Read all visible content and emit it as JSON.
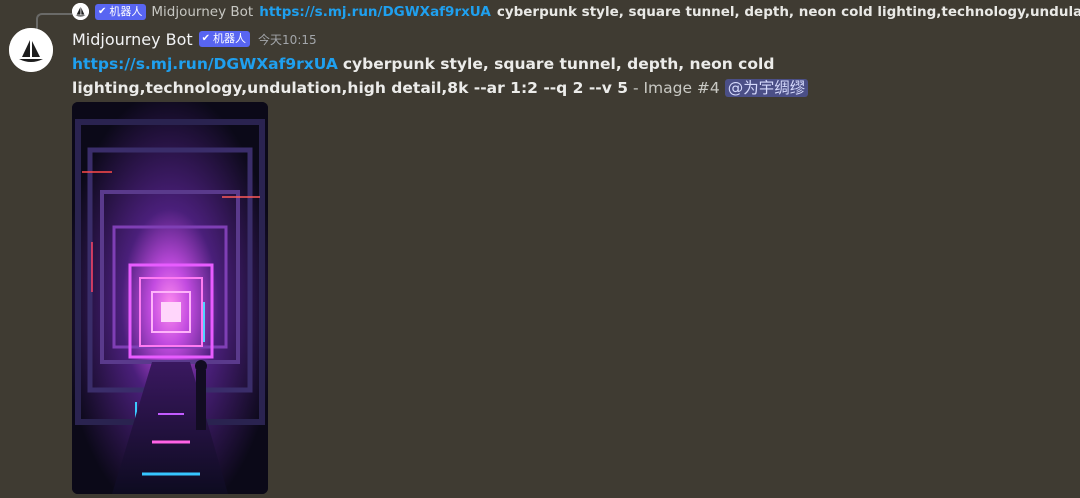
{
  "reply": {
    "bot_tag": "机器人",
    "author": "Midjourney Bot",
    "link": "https://s.mj.run/DGWXaf9rxUA",
    "text": "cyberpunk style, square tunnel, depth, neon cold lighting,technology,undula",
    "icon": "image-icon"
  },
  "message": {
    "author": "Midjourney Bot",
    "bot_tag": "机器人",
    "timestamp": "今天10:15",
    "link": "https://s.mj.run/DGWXaf9rxUA",
    "prompt": "cyberpunk style, square tunnel, depth, neon cold lighting,technology,undulation,high detail,8k --ar 1:2 --q 2 --v 5",
    "suffix": " - Image #4",
    "mention": "@为宇绸缪"
  },
  "colors": {
    "background": "#3f3b32",
    "link": "#1fa0ef",
    "bot_tag": "#5865f2",
    "mention_bg": "#4b4f87"
  }
}
